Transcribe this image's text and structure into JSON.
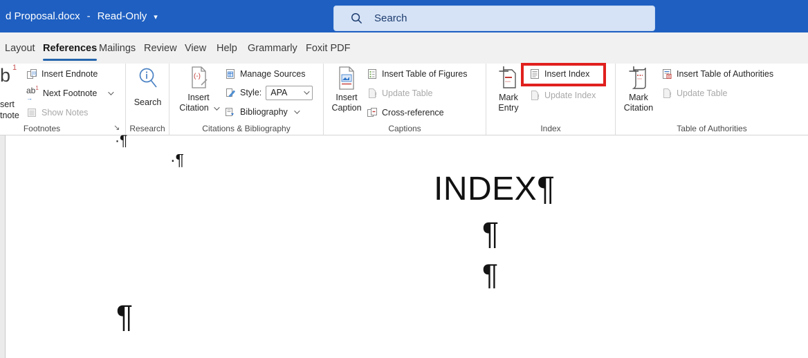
{
  "title_bar": {
    "document_title": "d Proposal.docx",
    "dash": "-",
    "mode_label": "Read-Only",
    "dropdown_glyph": "▾",
    "search_placeholder": "Search"
  },
  "tabs": [
    {
      "label": "Layout",
      "active": false
    },
    {
      "label": "References",
      "active": true
    },
    {
      "label": "Mailings",
      "active": false
    },
    {
      "label": "Review",
      "active": false
    },
    {
      "label": "View",
      "active": false
    },
    {
      "label": "Help",
      "active": false
    },
    {
      "label": "Grammarly",
      "active": false
    },
    {
      "label": "Foxit PDF",
      "active": false
    }
  ],
  "ribbon": {
    "footnotes": {
      "group_label": "Footnotes",
      "truncated_button": {
        "glyph": "b",
        "superscript": "1",
        "text_line1": "sert",
        "text_line2": "tnote"
      },
      "insert_endnote": "Insert Endnote",
      "next_footnote": "Next Footnote",
      "next_footnote_icon_text": "ab",
      "next_footnote_icon_sup": "1",
      "next_footnote_icon_arrow": "→",
      "show_notes": "Show Notes"
    },
    "research": {
      "group_label": "Research",
      "search_button": "Search"
    },
    "citations": {
      "group_label": "Citations & Bibliography",
      "insert_citation_line1": "Insert",
      "insert_citation_line2": "Citation",
      "manage_sources": "Manage Sources",
      "style_label": "Style:",
      "style_value": "APA",
      "bibliography": "Bibliography"
    },
    "captions": {
      "group_label": "Captions",
      "insert_caption_line1": "Insert",
      "insert_caption_line2": "Caption",
      "insert_table_of_figures": "Insert Table of Figures",
      "update_table": "Update Table",
      "cross_reference": "Cross-reference"
    },
    "index": {
      "group_label": "Index",
      "mark_entry_line1": "Mark",
      "mark_entry_line2": "Entry",
      "insert_index": "Insert Index",
      "update_index": "Update Index"
    },
    "authorities": {
      "group_label": "Table of Authorities",
      "mark_citation_line1": "Mark",
      "mark_citation_line2": "Citation",
      "insert_table_of_authorities": "Insert Table of Authorities",
      "update_table": "Update Table"
    },
    "dialog_launcher_glyph": "↘"
  },
  "document": {
    "heading": "INDEX",
    "pilcrow": "¶",
    "space_mark": "·"
  },
  "colors": {
    "title_bar_blue": "#1e5fc1",
    "search_box_fill": "#d6e3f6",
    "tab_underline_blue": "#2565ad",
    "highlight_red": "#e0201d",
    "disabled_gray": "#a8a8a8",
    "ribbon_background": "#ffffff"
  }
}
